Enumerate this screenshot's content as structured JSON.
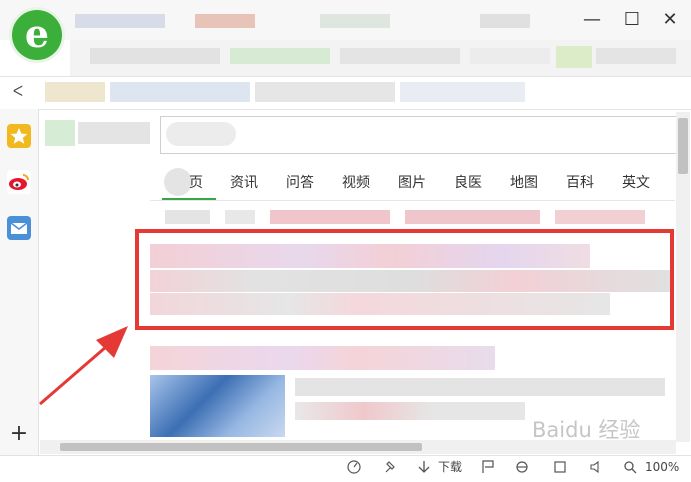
{
  "nav_tabs": [
    "页",
    "资讯",
    "问答",
    "视频",
    "图片",
    "良医",
    "地图",
    "百科",
    "英文"
  ],
  "status": {
    "download_label": "下载",
    "zoom": "100%"
  },
  "watermark": "Baidu 经验",
  "colors": {
    "highlight": "#e53935",
    "accent": "#3aa44a",
    "logo": "#3cae3a"
  },
  "icons": {
    "logo": "e",
    "back_toggle": "ᐸ",
    "add": "+",
    "minimize": "—",
    "maximize": "☐",
    "close": "✕"
  }
}
